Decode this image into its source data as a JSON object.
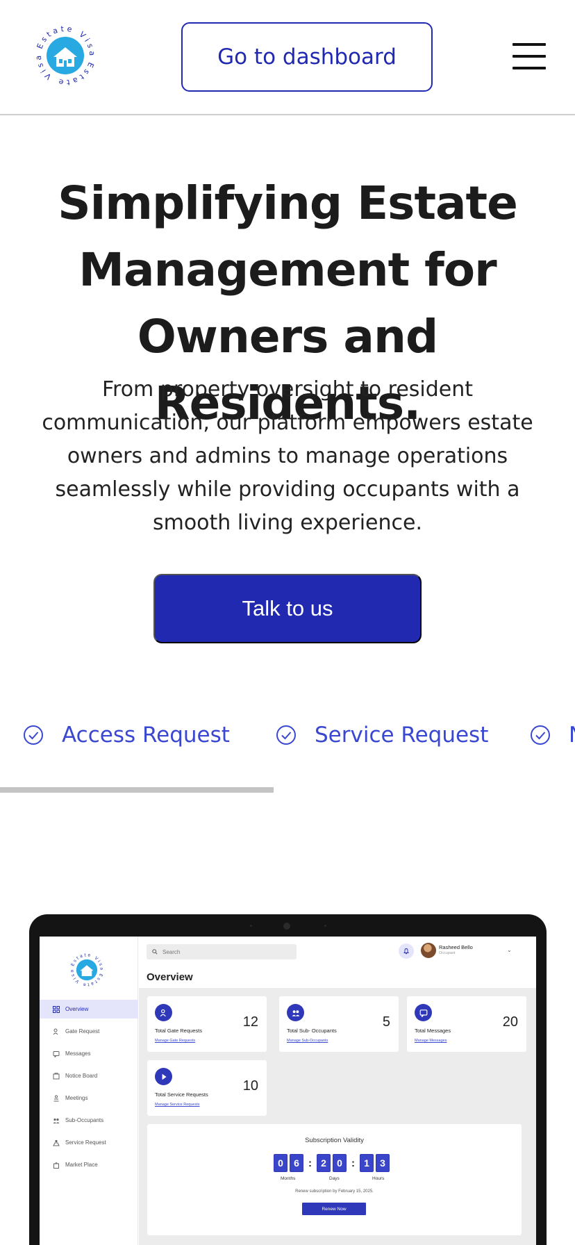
{
  "header": {
    "logo_text": "Estate Visa",
    "dashboard_button": "Go to dashboard",
    "menu_icon": "hamburger-menu-icon"
  },
  "hero": {
    "title_lines": [
      "Simplifying Estate",
      "Management for",
      "Owners and Residents."
    ],
    "subtitle": "From property oversight to resident communication, our platform empowers estate owners and admins to manage operations seamlessly while providing occupants with a smooth living experience.",
    "cta": "Talk to us"
  },
  "features": {
    "items": [
      {
        "label": "Access Request",
        "icon": "check-circle-icon"
      },
      {
        "label": "Service Request",
        "icon": "check-circle-icon"
      },
      {
        "label": "N",
        "icon": "check-circle-icon"
      }
    ],
    "scroll_progress": 0.476
  },
  "colors": {
    "brand": "#2029b0",
    "accent_text": "#3a47d1",
    "active_nav_bg": "#e4e4fb",
    "logo_blue": "#29a9e1"
  },
  "mockup": {
    "logo_text": "Estate Visa",
    "search_placeholder": "Search",
    "user": {
      "name": "Rasheed Bello",
      "role": "Occupant"
    },
    "page_title": "Overview",
    "nav": [
      {
        "label": "Overview",
        "active": true,
        "icon": "grid-icon"
      },
      {
        "label": "Gate Request",
        "active": false,
        "icon": "person-gate-icon"
      },
      {
        "label": "Messages",
        "active": false,
        "icon": "message-icon"
      },
      {
        "label": "Notice Board",
        "active": false,
        "icon": "notice-board-icon"
      },
      {
        "label": "Meetings",
        "active": false,
        "icon": "meetings-icon"
      },
      {
        "label": "Sub-Occupants",
        "active": false,
        "icon": "group-icon"
      },
      {
        "label": "Service Request",
        "active": false,
        "icon": "service-icon"
      },
      {
        "label": "Market Place",
        "active": false,
        "icon": "bag-icon"
      }
    ],
    "cards": [
      {
        "label": "Total Gate Requests",
        "value": "12",
        "link": "Manage Gate Requests",
        "icon": "gate-icon"
      },
      {
        "label": "Total Sub- Occupants",
        "value": "5",
        "link": "Manage Sub-Occupants",
        "icon": "group-icon"
      },
      {
        "label": "Total Messages",
        "value": "20",
        "link": "Manage Messages",
        "icon": "message-icon"
      },
      {
        "label": "Total Service Requests",
        "value": "10",
        "link": "Manage Service Requests",
        "icon": "service-icon"
      }
    ],
    "subscription": {
      "title": "Subscription Validity",
      "months": [
        "0",
        "6"
      ],
      "days": [
        "2",
        "0"
      ],
      "hours": [
        "1",
        "3"
      ],
      "labels": {
        "months": "Months",
        "days": "Days",
        "hours": "Hours"
      },
      "renew_text": "Renew subscription by February 15, 2025.",
      "renew_button": "Renew Now"
    }
  }
}
